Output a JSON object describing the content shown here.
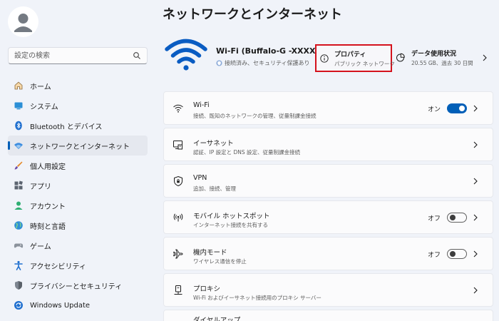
{
  "window": {
    "page_title": "ネットワークとインターネット"
  },
  "search": {
    "placeholder": "設定の検索"
  },
  "sidebar": {
    "items": [
      {
        "label": "ホーム",
        "icon": "home-icon",
        "active": false
      },
      {
        "label": "システム",
        "icon": "system-icon",
        "active": false
      },
      {
        "label": "Bluetooth とデバイス",
        "icon": "bluetooth-icon",
        "active": false
      },
      {
        "label": "ネットワークとインターネット",
        "icon": "network-icon",
        "active": true
      },
      {
        "label": "個人用設定",
        "icon": "brush-icon",
        "active": false
      },
      {
        "label": "アプリ",
        "icon": "apps-icon",
        "active": false
      },
      {
        "label": "アカウント",
        "icon": "account-icon",
        "active": false
      },
      {
        "label": "時刻と言語",
        "icon": "globe-icon",
        "active": false
      },
      {
        "label": "ゲーム",
        "icon": "gamepad-icon",
        "active": false
      },
      {
        "label": "アクセシビリティ",
        "icon": "accessibility-icon",
        "active": false
      },
      {
        "label": "プライバシーとセキュリティ",
        "icon": "shield-icon",
        "active": false
      },
      {
        "label": "Windows Update",
        "icon": "update-icon",
        "active": false
      }
    ]
  },
  "hero": {
    "network_name": "Wi-Fi (Buffalo-G -XXXX)",
    "status": "接続済み、セキュリティ保護あり",
    "properties_title": "プロパティ",
    "properties_sub": "パブリック ネットワーク",
    "usage_title": "データ使用状況",
    "usage_sub": "20.55 GB、過去 30 日間"
  },
  "cards": [
    {
      "title": "Wi-Fi",
      "sub": "接続、既知のネットワークの管理、従量制課金接続",
      "icon": "wifi-icon",
      "toggle": "on",
      "toggle_label": "オン"
    },
    {
      "title": "イーサネット",
      "sub": "認証、IP 設定と DNS 設定、従量制課金接続",
      "icon": "ethernet-icon"
    },
    {
      "title": "VPN",
      "sub": "追加、接続、管理",
      "icon": "vpn-shield-icon"
    },
    {
      "title": "モバイル ホットスポット",
      "sub": "インターネット接続を共有する",
      "icon": "hotspot-icon",
      "toggle": "off",
      "toggle_label": "オフ"
    },
    {
      "title": "機内モード",
      "sub": "ワイヤレス通信を停止",
      "icon": "airplane-icon",
      "toggle": "off",
      "toggle_label": "オフ"
    },
    {
      "title": "プロキシ",
      "sub": "Wi-Fi およびイーサネット接続用のプロキシ サーバー",
      "icon": "proxy-icon"
    },
    {
      "title": "ダイヤルアップ",
      "icon": "dialup-icon"
    }
  ],
  "colors": {
    "accent": "#005fb8",
    "highlight_box": "#d4121d",
    "background": "#f0f3f9"
  }
}
